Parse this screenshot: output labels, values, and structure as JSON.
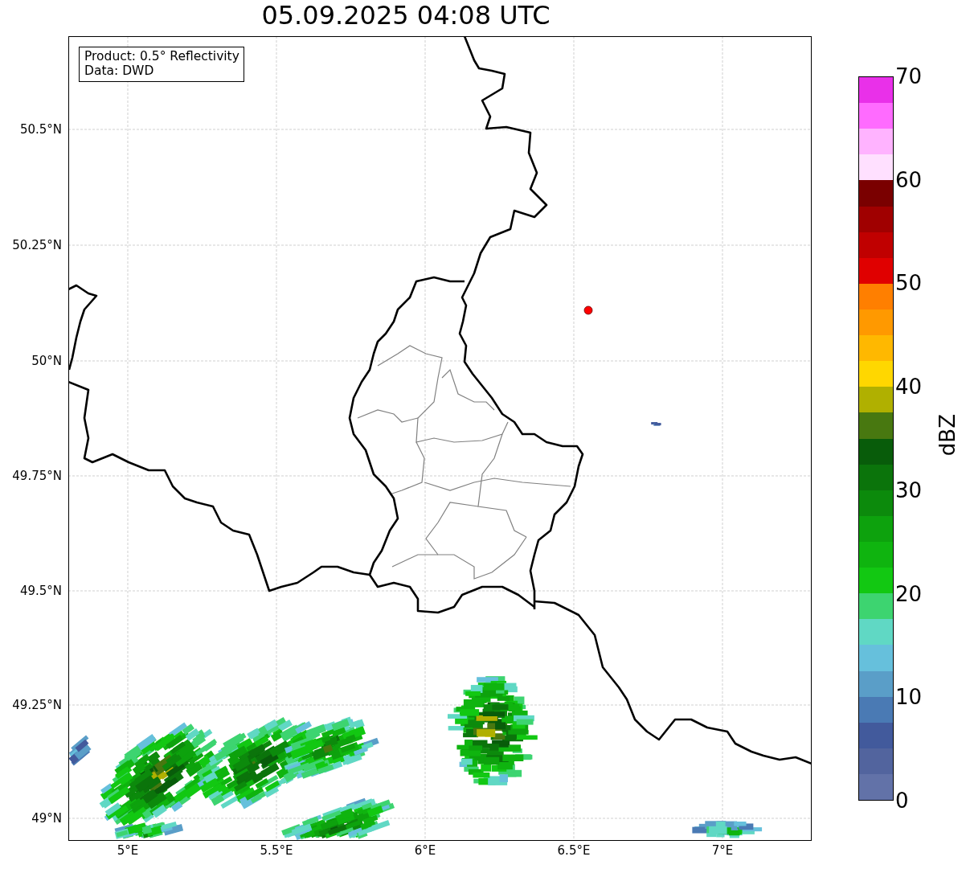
{
  "title": "05.09.2025 04:08 UTC",
  "info_box": {
    "lines": [
      "Product: 0.5° Reflectivity",
      "Data: DWD"
    ]
  },
  "map": {
    "y_ticks": [
      "50.5°N",
      "50.25°N",
      "50°N",
      "49.75°N",
      "49.5°N",
      "49.25°N",
      "49°N"
    ],
    "x_ticks": [
      "5°E",
      "5.5°E",
      "6°E",
      "6.5°E",
      "7°E"
    ]
  },
  "colorbar": {
    "label": "dBZ",
    "ticks": [
      "70",
      "60",
      "50",
      "40",
      "30",
      "20",
      "10",
      "0"
    ],
    "bins": [
      {
        "color": "#e930e9"
      },
      {
        "color": "#ff6bff"
      },
      {
        "color": "#ffb3ff"
      },
      {
        "color": "#ffe0ff"
      },
      {
        "color": "#7a0000"
      },
      {
        "color": "#a00000"
      },
      {
        "color": "#c00000"
      },
      {
        "color": "#e00000"
      },
      {
        "color": "#ff7f00"
      },
      {
        "color": "#ff9900"
      },
      {
        "color": "#ffb800"
      },
      {
        "color": "#ffd700"
      },
      {
        "color": "#b0b000"
      },
      {
        "color": "#487810"
      },
      {
        "color": "#085c0a"
      },
      {
        "color": "#0b740b"
      },
      {
        "color": "#0c8a0c"
      },
      {
        "color": "#0da20d"
      },
      {
        "color": "#0fb40f"
      },
      {
        "color": "#12c812"
      },
      {
        "color": "#3dd470"
      },
      {
        "color": "#60d8c4"
      },
      {
        "color": "#66c0dc"
      },
      {
        "color": "#5a9ec8"
      },
      {
        "color": "#4a7ab4"
      },
      {
        "color": "#425a9c"
      },
      {
        "color": "#52649e"
      },
      {
        "color": "#6272a8"
      }
    ]
  }
}
